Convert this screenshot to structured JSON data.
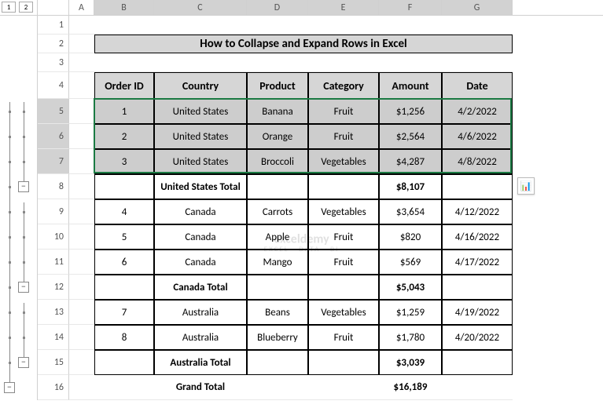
{
  "outline_levels": [
    "1",
    "2"
  ],
  "columns": [
    "A",
    "B",
    "C",
    "D",
    "E",
    "F",
    "G"
  ],
  "title": "How to Collapse and Expand Rows in Excel",
  "headers": {
    "order_id": "Order ID",
    "country": "Country",
    "product": "Product",
    "category": "Category",
    "amount": "Amount",
    "date": "Date"
  },
  "rows": [
    {
      "n": 1
    },
    {
      "n": 2,
      "title": true
    },
    {
      "n": 3
    },
    {
      "n": 4,
      "header": true
    },
    {
      "n": 5,
      "sel": true,
      "d": {
        "order_id": "1",
        "country": "United States",
        "product": "Banana",
        "category": "Fruit",
        "amount": "$1,256",
        "date": "4/2/2022"
      }
    },
    {
      "n": 6,
      "sel": true,
      "d": {
        "order_id": "2",
        "country": "United States",
        "product": "Orange",
        "category": "Fruit",
        "amount": "$2,564",
        "date": "4/6/2022"
      }
    },
    {
      "n": 7,
      "sel": true,
      "d": {
        "order_id": "3",
        "country": "United States",
        "product": "Broccoli",
        "category": "Vegetables",
        "amount": "$4,287",
        "date": "4/8/2022"
      }
    },
    {
      "n": 8,
      "subtotal": true,
      "label": "United States Total",
      "amount": "$8,107"
    },
    {
      "n": 9,
      "d": {
        "order_id": "4",
        "country": "Canada",
        "product": "Carrots",
        "category": "Vegetables",
        "amount": "$3,654",
        "date": "4/12/2022"
      }
    },
    {
      "n": 10,
      "d": {
        "order_id": "5",
        "country": "Canada",
        "product": "Apple",
        "category": "Fruit",
        "amount": "$820",
        "date": "4/16/2022"
      }
    },
    {
      "n": 11,
      "d": {
        "order_id": "6",
        "country": "Canada",
        "product": "Mango",
        "category": "Fruit",
        "amount": "$569",
        "date": "4/17/2022"
      }
    },
    {
      "n": 12,
      "subtotal": true,
      "label": "Canada  Total",
      "amount": "$5,043"
    },
    {
      "n": 13,
      "d": {
        "order_id": "7",
        "country": "Australia",
        "product": "Beans",
        "category": "Vegetables",
        "amount": "$1,259",
        "date": "4/19/2022"
      }
    },
    {
      "n": 14,
      "d": {
        "order_id": "8",
        "country": "Australia",
        "product": "Blueberry",
        "category": "Fruit",
        "amount": "$1,780",
        "date": "4/20/2022"
      }
    },
    {
      "n": 15,
      "subtotal": true,
      "label": "Australia  Total",
      "amount": "$3,039"
    },
    {
      "n": 16,
      "grand": true,
      "label": "Grand Total",
      "amount": "$16,189"
    }
  ],
  "watermark": {
    "brand": "exceldemy",
    "sub": "EXCEL · DATA · BI"
  },
  "icons": {
    "minus": "−",
    "qa": "📊"
  }
}
